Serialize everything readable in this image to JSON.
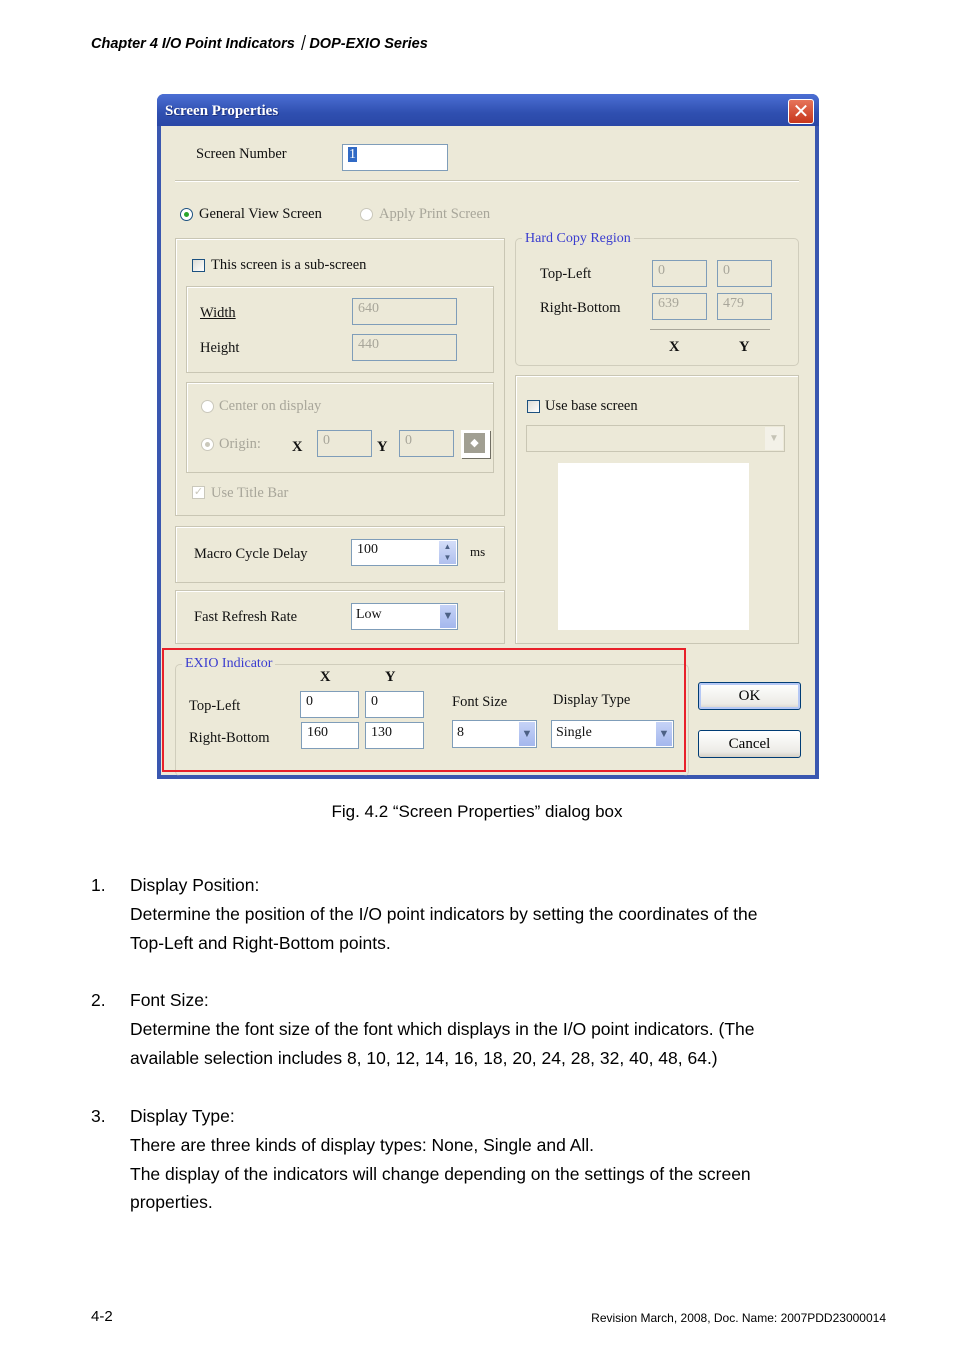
{
  "page_header": "Chapter 4 I/O Point Indicators｜DOP-EXIO Series",
  "dialog": {
    "title": "Screen Properties",
    "close_icon": "close-icon",
    "screen_number": {
      "label": "Screen Number",
      "value": "1"
    },
    "view_mode": {
      "general_view": {
        "label": "General View Screen",
        "selected": true
      },
      "apply_print": {
        "label": "Apply Print Screen",
        "selected": false,
        "disabled": true
      }
    },
    "sub_screen": {
      "checkbox_label": "This screen is a sub-screen",
      "checked": false,
      "width": {
        "label": "Width",
        "value": "640"
      },
      "height": {
        "label": "Height",
        "value": "440"
      },
      "center_on_display": {
        "label": "Center on display"
      },
      "origin": {
        "label": "Origin:",
        "x_label": "X",
        "x_value": "0",
        "y_label": "Y",
        "y_value": "0"
      },
      "use_title_bar": {
        "label": "Use Title Bar",
        "checked": true
      }
    },
    "hard_copy": {
      "title": "Hard Copy Region",
      "top_left": {
        "label": "Top-Left",
        "x": "0",
        "y": "0"
      },
      "right_bottom": {
        "label": "Right-Bottom",
        "x": "639",
        "y": "479"
      },
      "x_label": "X",
      "y_label": "Y"
    },
    "base_screen": {
      "label": "Use base screen",
      "checked": false,
      "selected": ""
    },
    "macro_cycle_delay": {
      "label": "Macro Cycle Delay",
      "value": "100",
      "unit": "ms"
    },
    "fast_refresh_rate": {
      "label": "Fast Refresh Rate",
      "value": "Low"
    },
    "exio_indicator": {
      "title": "EXIO Indicator",
      "x_label": "X",
      "y_label": "Y",
      "top_left": {
        "label": "Top-Left",
        "x": "0",
        "y": "0"
      },
      "right_bottom": {
        "label": "Right-Bottom",
        "x": "160",
        "y": "130"
      },
      "font_size": {
        "label": "Font Size",
        "value": "8"
      },
      "display_type": {
        "label": "Display Type",
        "value": "Single"
      }
    },
    "ok_label": "OK",
    "cancel_label": "Cancel",
    "highlight_color": "#e8202a"
  },
  "caption": "Fig. 4.2 “Screen Properties” dialog box",
  "items": [
    {
      "num": "1.",
      "title": "Display Position:",
      "lines": [
        "Determine the position of the I/O point indicators by setting the coordinates of the",
        "Top-Left and Right-Bottom points."
      ]
    },
    {
      "num": "2.",
      "title": "Font Size:",
      "lines": [
        "Determine the font size of the font which displays in the I/O point indicators. (The",
        "available selection includes 8, 10, 12, 14, 16, 18, 20, 24, 28, 32, 40, 48, 64.)"
      ]
    },
    {
      "num": "3.",
      "title": "Display Type:",
      "lines": [
        "There are three kinds of display types: None, Single and All.",
        "The display of the indicators will change depending on the settings of the screen",
        "properties."
      ]
    }
  ],
  "footer": {
    "page": "4-2",
    "revision": "Revision March, 2008, Doc. Name: 2007PDD23000014"
  }
}
